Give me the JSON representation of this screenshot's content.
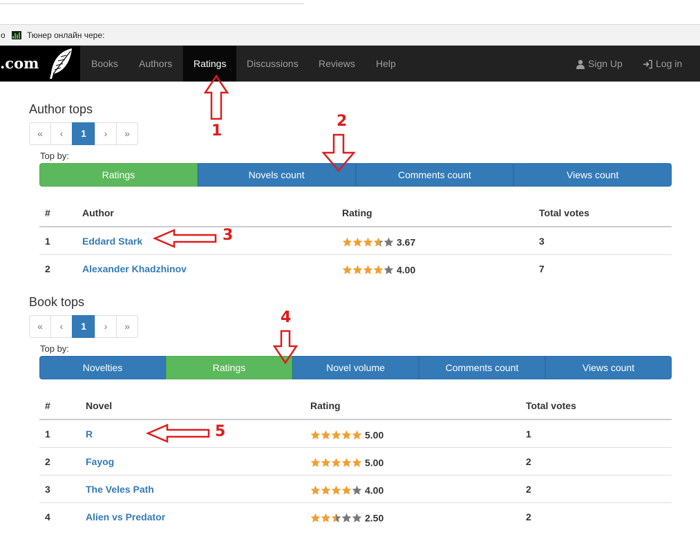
{
  "browser": {
    "bookmark_fragment": "о",
    "bookmark_label": "Тюнер онлайн чере:"
  },
  "navbar": {
    "brand": ".com",
    "items": [
      "Books",
      "Authors",
      "Ratings",
      "Discussions",
      "Reviews",
      "Help"
    ],
    "active": "Ratings",
    "signup": "Sign Up",
    "login": "Log in"
  },
  "author_tops": {
    "title": "Author tops",
    "pagination": [
      "«",
      "‹",
      "1",
      "›",
      "»"
    ],
    "top_by_label": "Top by:",
    "buttons": [
      "Ratings",
      "Novels count",
      "Comments count",
      "Views count"
    ],
    "active_button": "Ratings",
    "columns": [
      "#",
      "Author",
      "Rating",
      "Total votes"
    ],
    "rows": [
      {
        "num": "1",
        "name": "Eddard Stark",
        "stars": 3.67,
        "rating": "3.67",
        "votes": "3"
      },
      {
        "num": "2",
        "name": "Alexander Khadzhinov",
        "stars": 4.0,
        "rating": "4.00",
        "votes": "7"
      }
    ]
  },
  "book_tops": {
    "title": "Book tops",
    "pagination": [
      "«",
      "‹",
      "1",
      "›",
      "»"
    ],
    "top_by_label": "Top by:",
    "buttons": [
      "Novelties",
      "Ratings",
      "Novel volume",
      "Comments count",
      "Views count"
    ],
    "active_button": "Ratings",
    "columns": [
      "#",
      "Novel",
      "Rating",
      "Total votes"
    ],
    "rows": [
      {
        "num": "1",
        "name": "R",
        "stars": 5.0,
        "rating": "5.00",
        "votes": "1"
      },
      {
        "num": "2",
        "name": "Fayog",
        "stars": 5.0,
        "rating": "5.00",
        "votes": "2"
      },
      {
        "num": "3",
        "name": "The Veles Path",
        "stars": 4.0,
        "rating": "4.00",
        "votes": "2"
      },
      {
        "num": "4",
        "name": "Alien vs Predator",
        "stars": 2.5,
        "rating": "2.50",
        "votes": "2"
      }
    ]
  },
  "annotations": [
    "1",
    "2",
    "3",
    "4",
    "5"
  ],
  "colors": {
    "navbar": "#222222",
    "primary": "#337ab7",
    "success": "#5cb85c",
    "star": "#f0a030",
    "star_empty": "#777777",
    "annotation": "#e01b1b"
  }
}
